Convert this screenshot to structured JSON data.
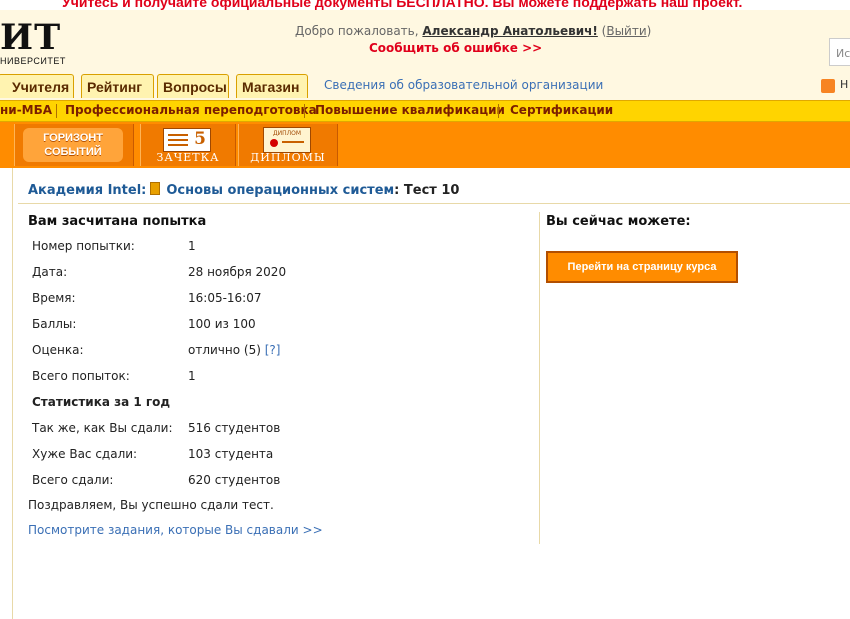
{
  "banner": {
    "text": "Учитесь и получайте официальные документы БЕСПЛАТНО. Вы можете поддержать наш проект."
  },
  "logo": {
    "text": "ИТ",
    "sub": "НИВЕРСИТЕТ"
  },
  "header": {
    "welcome_prefix": "Добро пожаловать,",
    "user_name": "Александр Анатольевич!",
    "logout_open": "(",
    "logout_label": "Выйти",
    "logout_close": ")",
    "report_error": "Сообщить об ошибке >>",
    "search_placeholder": "Ис"
  },
  "tabs": [
    {
      "label": "Учителя"
    },
    {
      "label": "Рейтинг"
    },
    {
      "label": "Вопросы"
    },
    {
      "label": "Магазин"
    }
  ],
  "org_link": "Сведения об образовательной организации",
  "rss_label": "Н",
  "nav2": [
    {
      "label": "ни-МБА"
    },
    {
      "label": "Профессиональная переподготовка"
    },
    {
      "label": "Повышение квалификации"
    },
    {
      "label": "Сертификации"
    }
  ],
  "bar3": {
    "horizon_line1": "ГОРИЗОНТ",
    "horizon_line2": "СОБЫТИЙ",
    "zachetka_label": "ЗАЧЕТКА",
    "zachetka_number": "5",
    "diplomas_label": "ДИПЛОМЫ",
    "diploma_mini": "ДИПЛОМ"
  },
  "breadcrumb": {
    "academy": "Академия Intel:",
    "course": "Основы операционных систем",
    "test": ": Тест 10"
  },
  "result": {
    "title": "Вам засчитана попытка",
    "rows": [
      {
        "key": "Номер попытки:",
        "value": "1"
      },
      {
        "key": "Дата:",
        "value": "28 ноября 2020"
      },
      {
        "key": "Время:",
        "value": "16:05-16:07"
      },
      {
        "key": "Баллы:",
        "value": "100 из 100"
      },
      {
        "key": "Оценка:",
        "value": "отлично (5)",
        "help": "[?]"
      },
      {
        "key": "Всего попыток:",
        "value": "1"
      }
    ],
    "stats_title": "Статистика за 1 год",
    "stats": [
      {
        "key": "Так же, как Вы сдали:",
        "value": "516 студентов"
      },
      {
        "key": "Хуже Вас сдали:",
        "value": "103 студента"
      },
      {
        "key": "Всего сдали:",
        "value": "620 студентов"
      }
    ],
    "congrats": "Поздравляем, Вы успешно сдали тест.",
    "view_tasks": "Посмотрите задания, которые Вы сдавали >>"
  },
  "actions": {
    "title": "Вы сейчас можете:",
    "go_course": "Перейти на страницу курса"
  },
  "colors": {
    "accent_orange": "#ff8c00",
    "nav_yellow": "#ffd400",
    "link_blue": "#1e5a96",
    "error_red": "#e0001b"
  }
}
